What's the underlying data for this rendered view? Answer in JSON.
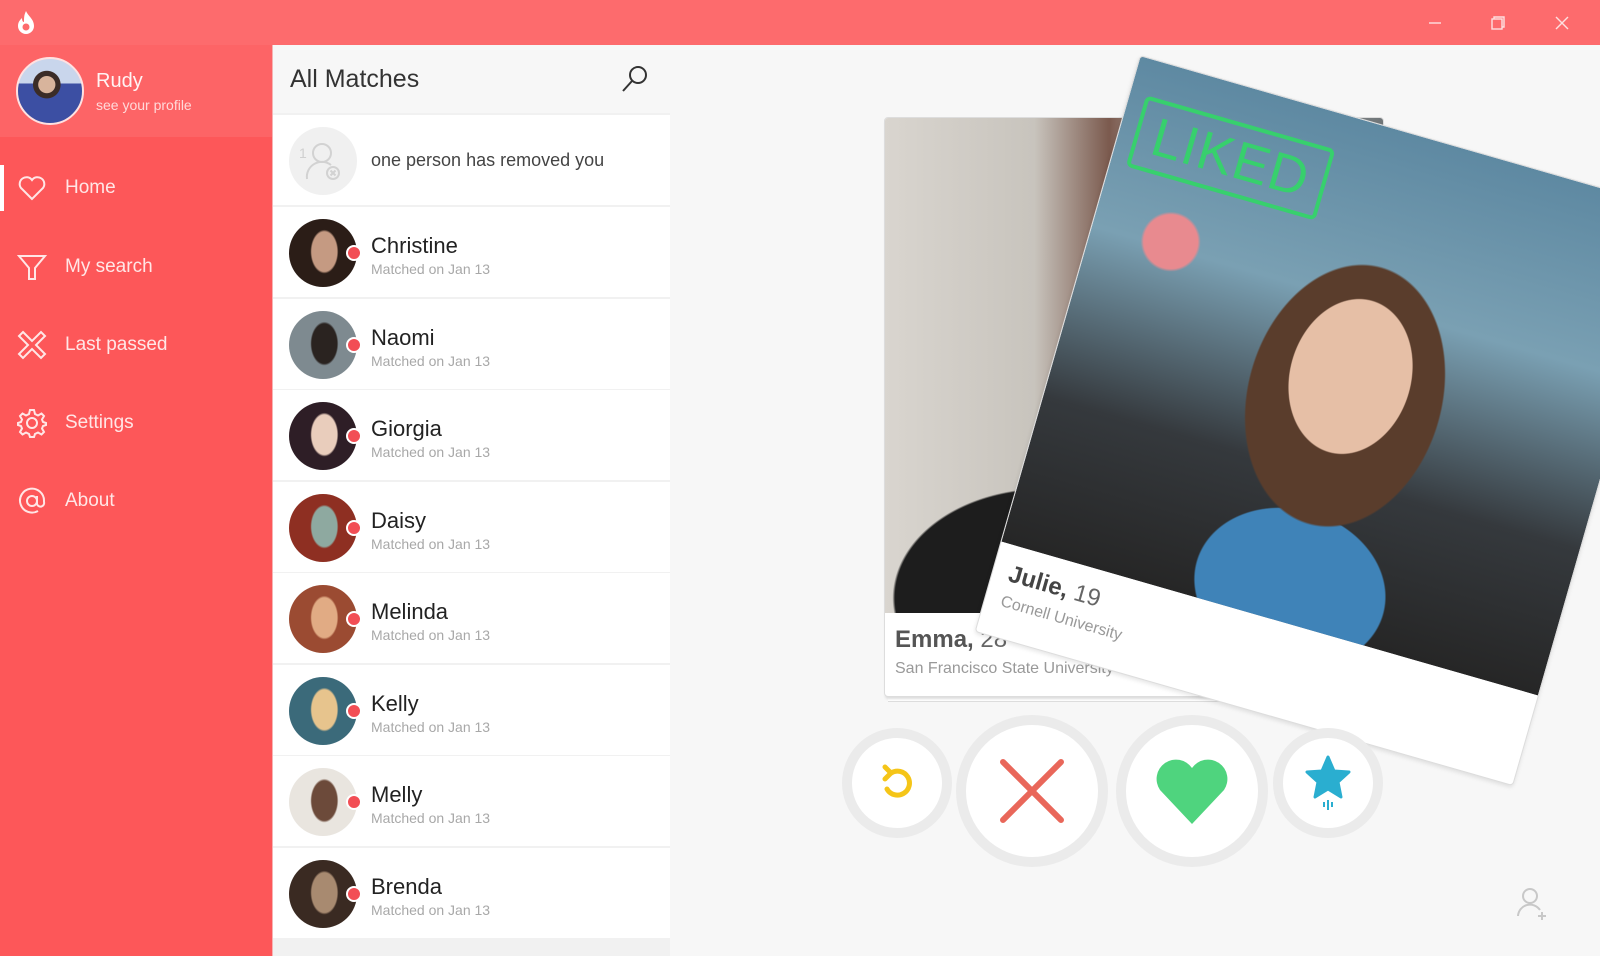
{
  "app": {
    "logo_icon": "flame-icon",
    "window_controls": {
      "minimize": "minimize-icon",
      "restore": "restore-icon",
      "close": "close-icon"
    }
  },
  "profile": {
    "name": "Rudy",
    "subtitle": "see your profile"
  },
  "sidebar": {
    "items": [
      {
        "label": "Home",
        "icon": "heart-outline-icon",
        "active": true
      },
      {
        "label": "My search",
        "icon": "filter-icon",
        "active": false
      },
      {
        "label": "Last passed",
        "icon": "x-outline-icon",
        "active": false
      },
      {
        "label": "Settings",
        "icon": "gear-icon",
        "active": false
      },
      {
        "label": "About",
        "icon": "at-icon",
        "active": false
      }
    ]
  },
  "matches": {
    "title": "All Matches",
    "search_icon": "search-icon",
    "removed_notice": {
      "count": "1",
      "text": "one person has removed you"
    },
    "items": [
      {
        "name": "Christine",
        "subtitle": "Matched on Jan 13",
        "colors": [
          "#2b1d17",
          "#c59a82"
        ]
      },
      {
        "name": "Naomi",
        "subtitle": "Matched on Jan 13",
        "colors": [
          "#7e8a90",
          "#2a2320"
        ]
      },
      {
        "name": "Giorgia",
        "subtitle": "Matched on Jan 13",
        "colors": [
          "#2e1e26",
          "#e9cdbc"
        ]
      },
      {
        "name": "Daisy",
        "subtitle": "Matched on Jan 13",
        "colors": [
          "#8e2f22",
          "#8ea9a0"
        ]
      },
      {
        "name": "Melinda",
        "subtitle": "Matched on Jan 13",
        "colors": [
          "#9b4b32",
          "#e1ab84"
        ]
      },
      {
        "name": "Kelly",
        "subtitle": "Matched on Jan 13",
        "colors": [
          "#3b6a7a",
          "#e7c48d"
        ]
      },
      {
        "name": "Melly",
        "subtitle": "Matched on Jan 13",
        "colors": [
          "#e9e5df",
          "#6c4a3a"
        ]
      },
      {
        "name": "Brenda",
        "subtitle": "Matched on Jan 13",
        "colors": [
          "#3a2a22",
          "#a88a70"
        ]
      }
    ]
  },
  "cards": {
    "back": {
      "name": "Emma,",
      "age": "28",
      "school": "San Francisco State University"
    },
    "front": {
      "name": "Julie,",
      "age": "19",
      "school": "Cornell University",
      "stamp": "LIKED"
    }
  },
  "actions": {
    "rewind": {
      "icon": "rewind-icon",
      "color": "#f5c518"
    },
    "nope": {
      "icon": "x-icon",
      "color": "#e9675a"
    },
    "like": {
      "icon": "heart-icon",
      "color": "#4fd47e"
    },
    "super_like": {
      "icon": "star-icon",
      "color": "#2aaed0"
    }
  },
  "colors": {
    "brand": "#fd5759",
    "titlebar": "#fd6b6d",
    "badge": "#f24e55",
    "liked": "#37d06d"
  }
}
